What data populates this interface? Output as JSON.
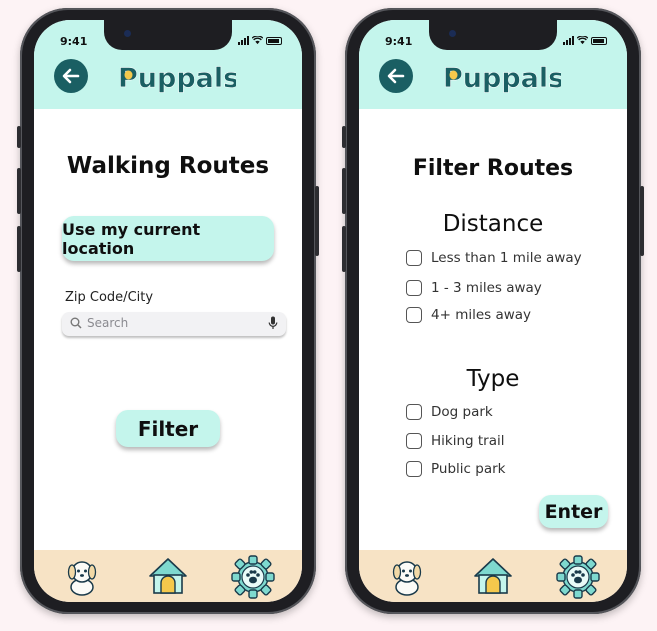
{
  "status": {
    "time": "9:41"
  },
  "app": {
    "name": "Puppals"
  },
  "left_screen": {
    "title": "Walking Routes",
    "location_button": "Use my current location",
    "zip_label": "Zip Code/City",
    "search_placeholder": "Search",
    "filter_button": "Filter"
  },
  "right_screen": {
    "title": "Filter Routes",
    "distance_heading": "Distance",
    "distance_options": [
      "Less than 1 mile away",
      "1 - 3 miles away",
      "4+ miles away"
    ],
    "type_heading": "Type",
    "type_options": [
      "Dog park",
      "Hiking trail",
      "Public park"
    ],
    "enter_button": "Enter"
  },
  "footer": {
    "icons": [
      "dog-icon",
      "house-icon",
      "settings-paw-icon"
    ]
  },
  "colors": {
    "header_bg": "#c4f5ec",
    "footer_bg": "#f7e3c5",
    "back_button": "#1a5f63",
    "logo_text": "#1a5f63",
    "logo_accent": "#f5c84c",
    "button_bg": "#c4f5ec"
  }
}
